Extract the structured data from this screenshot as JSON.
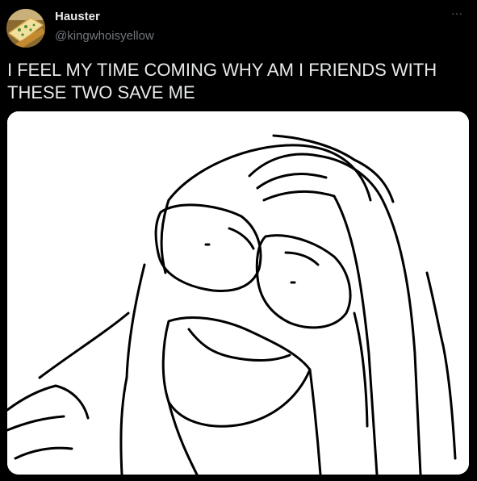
{
  "tweet": {
    "author_name": "Hauster",
    "author_handle": "@kingwhoisyellow",
    "text": "I FEEL MY TIME COMING WHY AM I FRIENDS WITH THESE TWO SAVE ME",
    "more_label": "···"
  },
  "icons": {
    "avatar": "garlic-bread-avatar",
    "more": "more-options-icon"
  },
  "colors": {
    "background": "#000000",
    "text_primary": "#e7e9ea",
    "text_secondary": "#71767b",
    "media_background": "#ffffff"
  }
}
